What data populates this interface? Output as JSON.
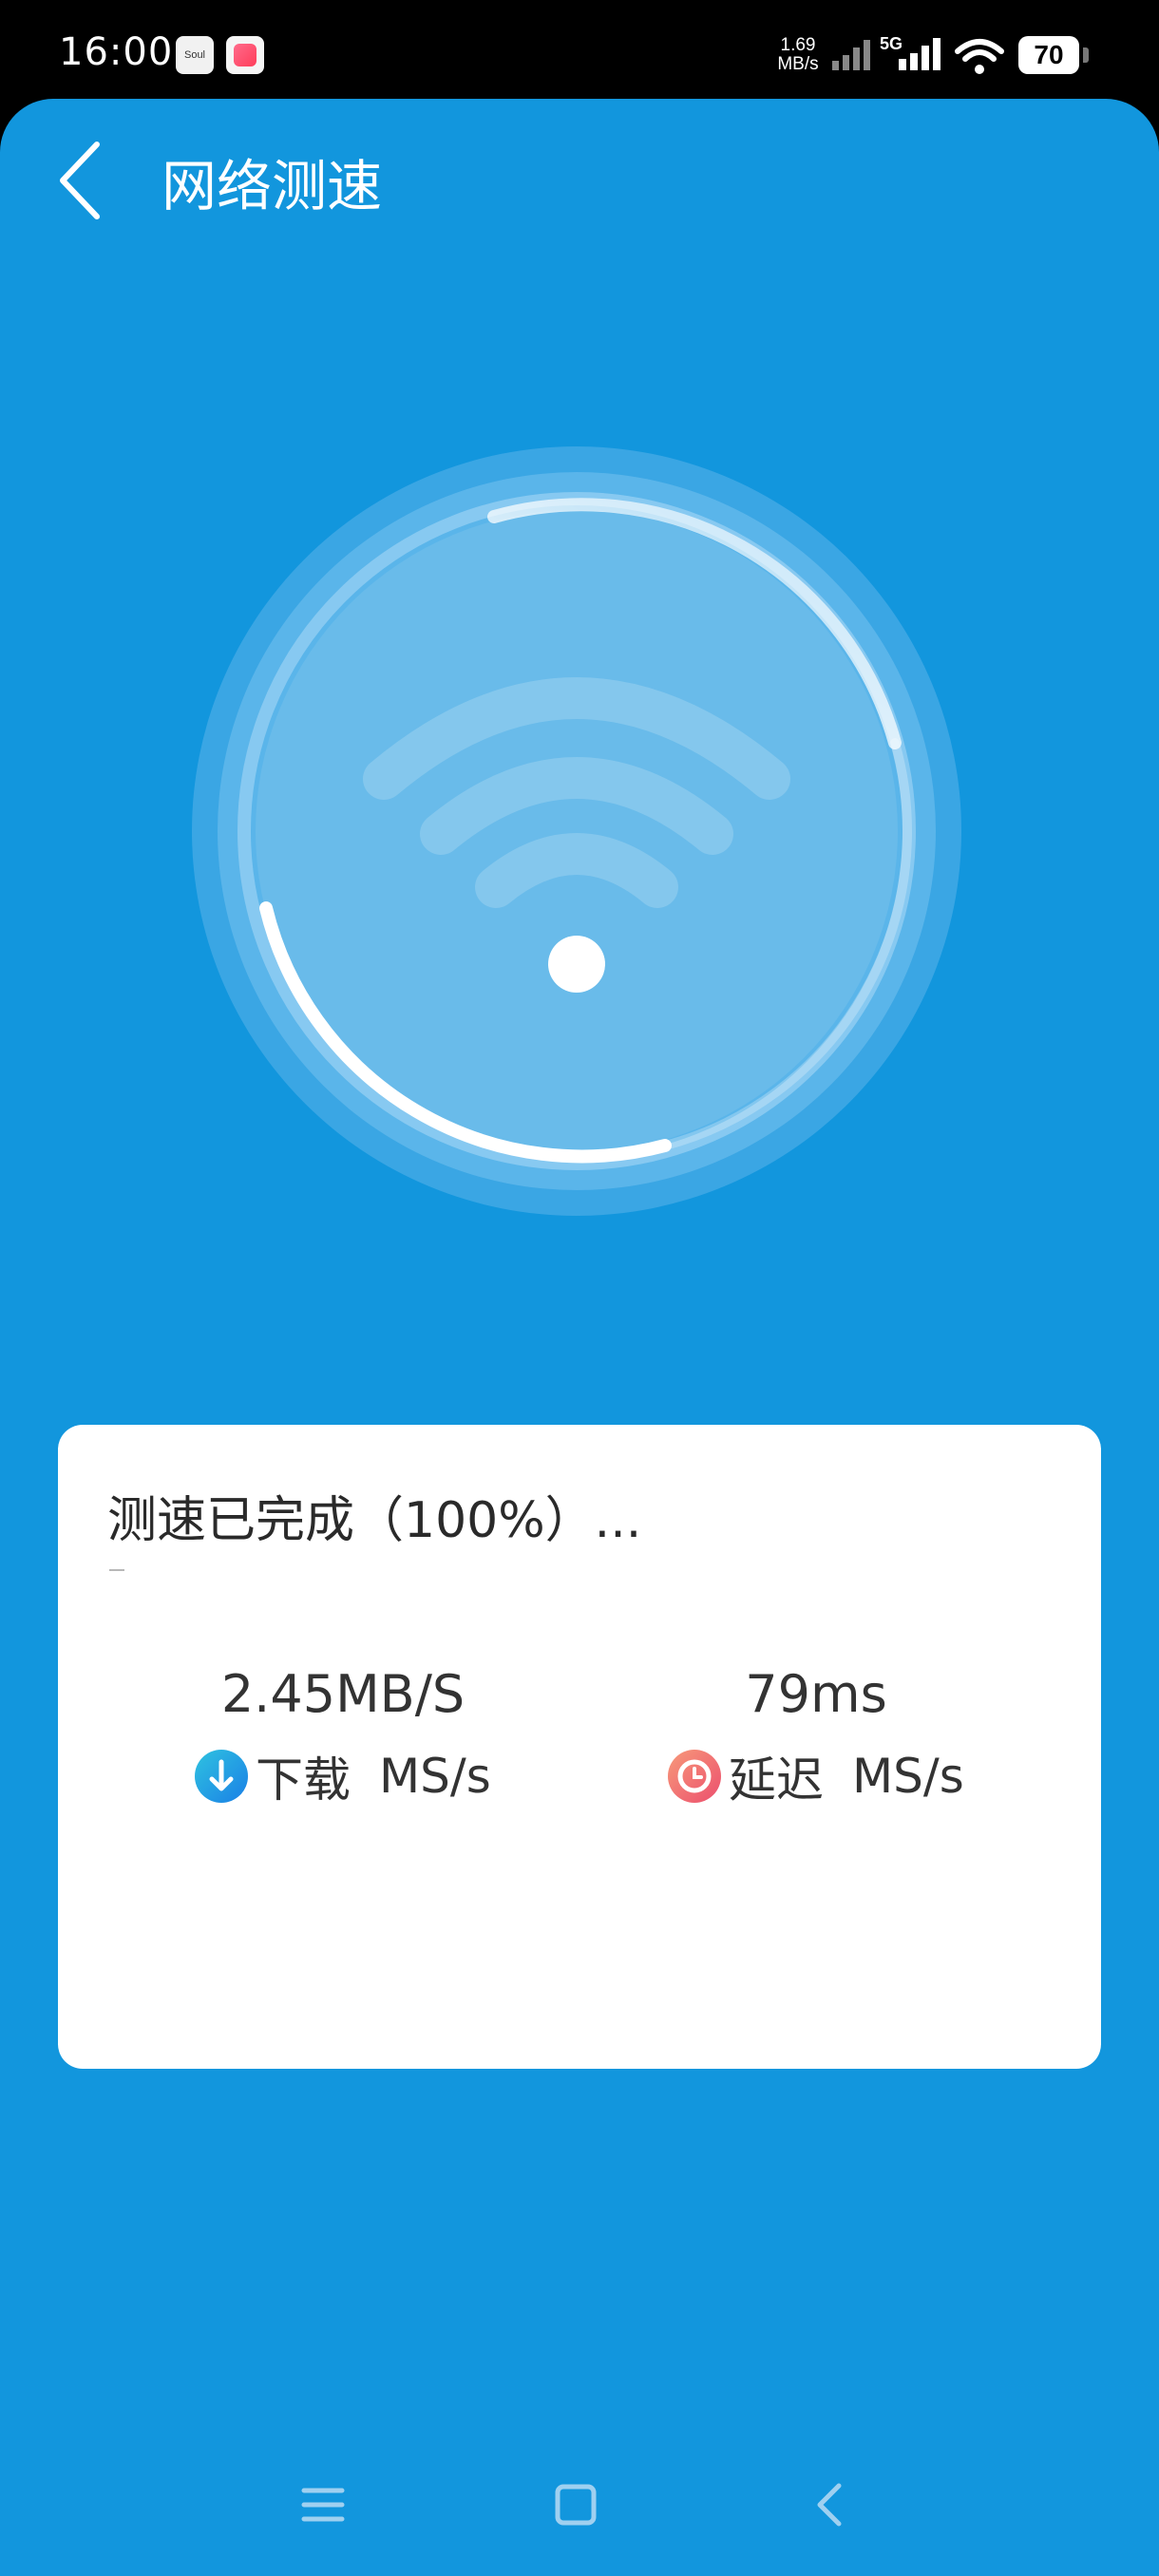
{
  "status_bar": {
    "time": "16:00",
    "app_icons": [
      "Soul",
      "pink-app"
    ],
    "net_speed_value": "1.69",
    "net_speed_unit": "MB/s",
    "network_type": "5G",
    "battery": "70"
  },
  "header": {
    "title": "网络测速",
    "back_icon": "chevron-left-icon"
  },
  "gauge": {
    "icon": "wifi-icon",
    "progress_percent": 100
  },
  "result_card": {
    "status": "测速已完成（100%）...",
    "download": {
      "value": "2.45MB/S",
      "label": "下载",
      "unit": "MS/s",
      "icon": "download-arrow-icon"
    },
    "latency": {
      "value": "79ms",
      "label": "延迟",
      "unit": "MS/s",
      "icon": "clock-icon"
    }
  },
  "nav_bar": {
    "items": [
      "menu-icon",
      "home-icon",
      "back-icon"
    ]
  },
  "colors": {
    "background": "#1296dd",
    "card": "#ffffff",
    "download_icon": "#1aa0e8",
    "latency_icon": "#f26a6a"
  }
}
